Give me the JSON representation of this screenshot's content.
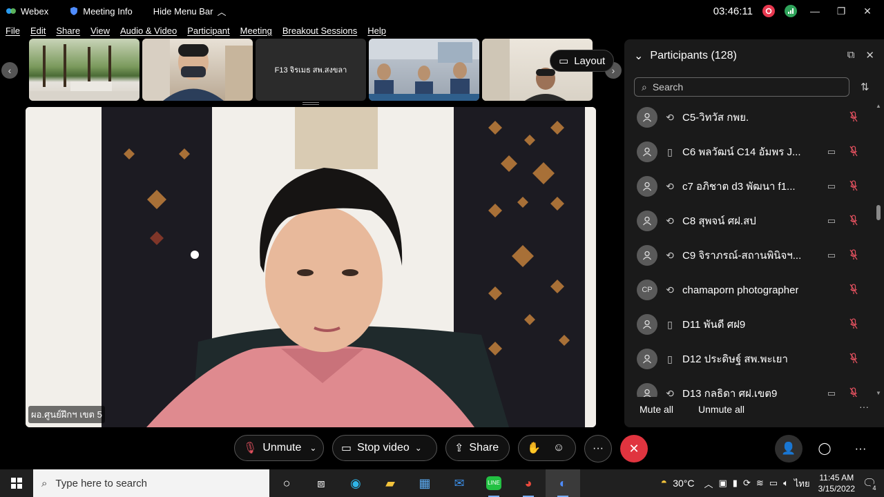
{
  "titlebar": {
    "app_name": "Webex",
    "meeting_info": "Meeting Info",
    "hide_menu": "Hide Menu Bar",
    "time": "03:46:11"
  },
  "menu": [
    "File",
    "Edit",
    "Share",
    "View",
    "Audio & Video",
    "Participant",
    "Meeting",
    "Breakout Sessions",
    "Help"
  ],
  "strip": {
    "text_tile": "F13 จิรเมธ สพ.สงขลา",
    "layout_label": "Layout"
  },
  "main_video": {
    "name": "ผอ.ศูนย์ฝึกฯ เขต 5"
  },
  "participants": {
    "title": "Participants (128)",
    "search_placeholder": "Search",
    "items": [
      {
        "name": "C5-วิทวัส กพย.",
        "avatar": "",
        "device": "sync",
        "cam": false
      },
      {
        "name": "C6 พลวัฒน์ C14 อัมพร J...",
        "avatar": "",
        "device": "phone",
        "cam": true
      },
      {
        "name": "c7 อภิชาต d3 พัฒนา f1...",
        "avatar": "",
        "device": "sync",
        "cam": true
      },
      {
        "name": "C8 สุพจน์ ศฝ.สป",
        "avatar": "",
        "device": "sync",
        "cam": true
      },
      {
        "name": "C9 จิราภรณ์-สถานพินิจฯ...",
        "avatar": "",
        "device": "sync",
        "cam": true
      },
      {
        "name": "chamaporn photographer",
        "avatar": "CP",
        "device": "sync",
        "cam": false
      },
      {
        "name": "D11 พันดี ศฝ9",
        "avatar": "",
        "device": "phone",
        "cam": false
      },
      {
        "name": "D12 ประดิษฐ์ สพ.พะเยา",
        "avatar": "",
        "device": "phone",
        "cam": false
      },
      {
        "name": "D13 กุลธิดา ศฝ.เขต9",
        "avatar": "",
        "device": "sync",
        "cam": true
      }
    ],
    "mute_all": "Mute all",
    "unmute_all": "Unmute all"
  },
  "controls": {
    "unmute": "Unmute",
    "stop_video": "Stop video",
    "share": "Share"
  },
  "taskbar": {
    "search_placeholder": "Type here to search",
    "temperature": "30°C",
    "language": "ไทย",
    "clock_time": "11:45 AM",
    "clock_date": "3/15/2022",
    "notif_count": "4"
  }
}
